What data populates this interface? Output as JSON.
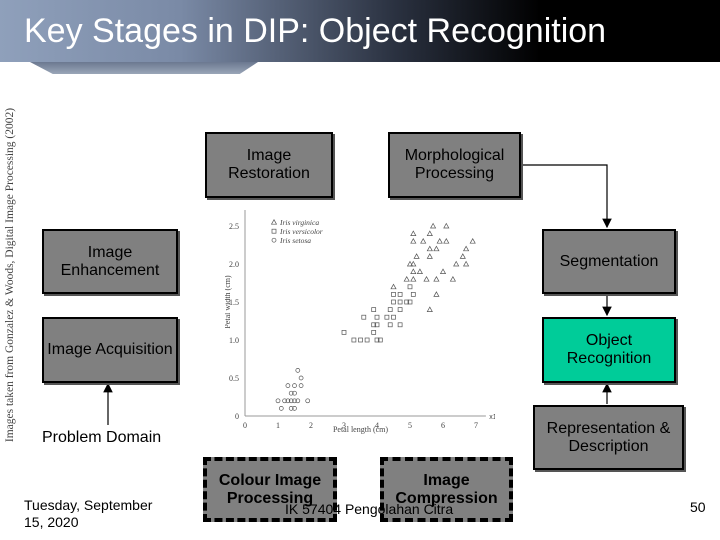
{
  "title": "Key Stages in DIP: Object Recognition",
  "side_credit": "Images taken from Gonzalez & Woods, Digital Image Processing (2002)",
  "stages": {
    "restoration": "Image Restoration",
    "morphological": "Morphological Processing",
    "enhancement": "Image Enhancement",
    "segmentation": "Segmentation",
    "acquisition": "Image Acquisition",
    "recognition": "Object Recognition",
    "representation": "Representation & Description",
    "colour": "Colour Image Processing",
    "compression": "Image Compression"
  },
  "problem_domain": "Problem Domain",
  "footer": {
    "date": "Tuesday, September 15, 2020",
    "course": "IK 57404 Pengolahan Citra",
    "page": "50"
  },
  "colors": {
    "box": "#808080",
    "highlight": "#00cc99"
  },
  "figure": {
    "type": "scatter",
    "xlabel": "Petal length (cm)",
    "ylabel": "Petal width (cm)",
    "x_axis_label": "x1",
    "y_axis_label": "x2",
    "xticks": [
      "0",
      "1",
      "2",
      "3",
      "4",
      "5",
      "6",
      "7"
    ],
    "yticks": [
      "0",
      "0.5",
      "1.0",
      "1.5",
      "2.0",
      "2.5"
    ],
    "legend": [
      "Iris virginica",
      "Iris versicolor",
      "Iris setosa"
    ],
    "series": [
      {
        "name": "Iris virginica",
        "points": [
          [
            5.7,
            2.5
          ],
          [
            6.1,
            2.5
          ],
          [
            5.1,
            2.4
          ],
          [
            5.6,
            2.4
          ],
          [
            5.1,
            2.3
          ],
          [
            5.4,
            2.3
          ],
          [
            5.9,
            2.3
          ],
          [
            6.1,
            2.3
          ],
          [
            6.9,
            2.3
          ],
          [
            5.6,
            2.2
          ],
          [
            5.8,
            2.2
          ],
          [
            6.7,
            2.2
          ],
          [
            5.2,
            2.1
          ],
          [
            5.6,
            2.1
          ],
          [
            6.6,
            2.1
          ],
          [
            5.0,
            2.0
          ],
          [
            5.1,
            2.0
          ],
          [
            6.4,
            2.0
          ],
          [
            6.7,
            2.0
          ],
          [
            5.1,
            1.9
          ],
          [
            5.3,
            1.9
          ],
          [
            6.0,
            1.9
          ],
          [
            4.9,
            1.8
          ],
          [
            5.1,
            1.8
          ],
          [
            5.5,
            1.8
          ],
          [
            5.8,
            1.8
          ],
          [
            6.3,
            1.8
          ],
          [
            4.5,
            1.7
          ],
          [
            5.8,
            1.6
          ],
          [
            5.6,
            1.4
          ]
        ]
      },
      {
        "name": "Iris versicolor",
        "points": [
          [
            5.0,
            1.7
          ],
          [
            4.5,
            1.6
          ],
          [
            4.7,
            1.6
          ],
          [
            5.1,
            1.6
          ],
          [
            4.5,
            1.5
          ],
          [
            4.7,
            1.5
          ],
          [
            4.9,
            1.5
          ],
          [
            5.0,
            1.5
          ],
          [
            3.9,
            1.4
          ],
          [
            4.4,
            1.4
          ],
          [
            4.7,
            1.4
          ],
          [
            3.6,
            1.3
          ],
          [
            4.0,
            1.3
          ],
          [
            4.3,
            1.3
          ],
          [
            4.5,
            1.3
          ],
          [
            3.9,
            1.2
          ],
          [
            4.0,
            1.2
          ],
          [
            4.4,
            1.2
          ],
          [
            4.7,
            1.2
          ],
          [
            3.0,
            1.1
          ],
          [
            3.9,
            1.1
          ],
          [
            3.3,
            1.0
          ],
          [
            3.5,
            1.0
          ],
          [
            3.7,
            1.0
          ],
          [
            4.0,
            1.0
          ],
          [
            4.1,
            1.0
          ]
        ]
      },
      {
        "name": "Iris setosa",
        "points": [
          [
            1.7,
            0.5
          ],
          [
            1.6,
            0.6
          ],
          [
            1.5,
            0.4
          ],
          [
            1.3,
            0.4
          ],
          [
            1.7,
            0.4
          ],
          [
            1.4,
            0.3
          ],
          [
            1.5,
            0.3
          ],
          [
            1.4,
            0.2
          ],
          [
            1.5,
            0.2
          ],
          [
            1.3,
            0.2
          ],
          [
            1.2,
            0.2
          ],
          [
            1.6,
            0.2
          ],
          [
            1.9,
            0.2
          ],
          [
            1.0,
            0.2
          ],
          [
            1.4,
            0.1
          ],
          [
            1.5,
            0.1
          ],
          [
            1.1,
            0.1
          ]
        ]
      }
    ]
  }
}
